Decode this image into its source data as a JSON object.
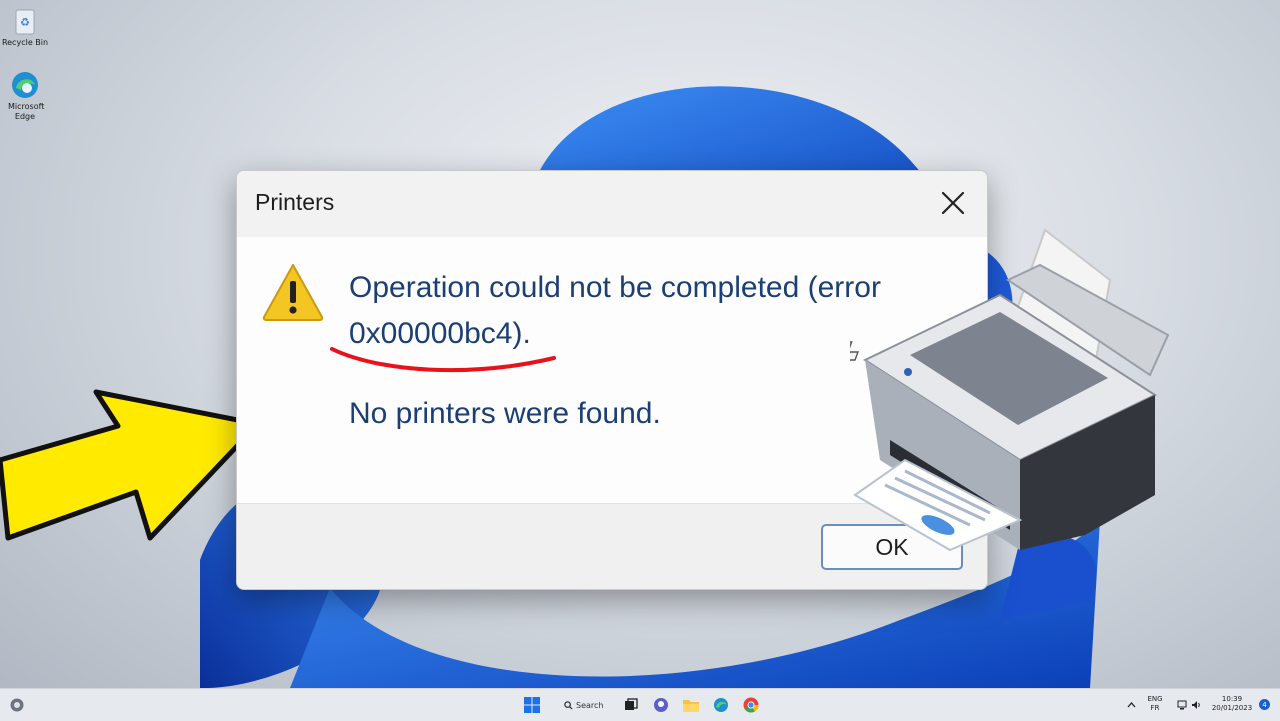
{
  "desktop": {
    "icons": [
      {
        "label": "Recycle Bin",
        "icon": "recycle-bin-icon"
      },
      {
        "label": "Microsoft Edge",
        "icon": "edge-icon"
      }
    ]
  },
  "dialog": {
    "title": "Printers",
    "message_line1": "Operation could not be completed (error",
    "error_code": "0x00000bc4",
    "message_line2_suffix": ").",
    "message_secondary": "No printers were found.",
    "ok_label": "OK",
    "icon": "warning-icon"
  },
  "annotations": {
    "underline_color": "#e8121b",
    "arrow_color": "#ffea00"
  },
  "taskbar": {
    "search_label": "Search",
    "apps": [
      "windows-start-icon",
      "search-icon",
      "task-view-icon",
      "chat-icon",
      "file-explorer-icon",
      "edge-icon",
      "chrome-icon"
    ],
    "language_top": "ENG",
    "language_bottom": "FR",
    "time": "10:39",
    "date": "20/01/2023",
    "notification_count": "4"
  }
}
